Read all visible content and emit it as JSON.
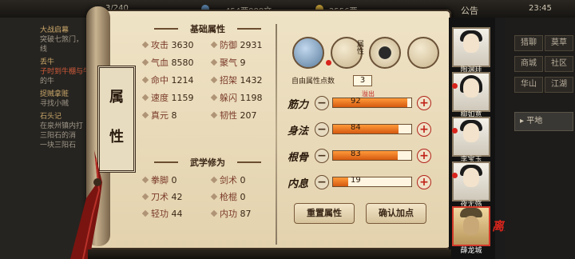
{
  "topbar": {
    "level_text": "3/240",
    "coins_text": "454两888文",
    "ingots_text": "2556两",
    "notice_label": "公告",
    "time": "23:45"
  },
  "quests": [
    {
      "title": "大战启幕",
      "desc": "突破七煞门，"
    },
    {
      "title": "",
      "desc": "线"
    },
    {
      "title": "丢牛",
      "desc": "子时到牛棚与牛"
    },
    {
      "title": "",
      "desc": "的牛"
    },
    {
      "title": "捉贼拿赃",
      "desc": "寻找小贼"
    },
    {
      "title": "石头记",
      "desc": "在泉州镇内打"
    },
    {
      "title": "",
      "desc": "三阳石的消"
    },
    {
      "title": "",
      "desc": "一块三阳石"
    }
  ],
  "title_scroll": {
    "char1": "属",
    "char2": "性"
  },
  "basic_section": {
    "title": "基础属性",
    "stats": [
      {
        "label": "攻击",
        "value": "3630"
      },
      {
        "label": "防御",
        "value": "2931"
      },
      {
        "label": "气血",
        "value": "8580"
      },
      {
        "label": "聚气",
        "value": "9"
      },
      {
        "label": "命中",
        "value": "1214"
      },
      {
        "label": "招架",
        "value": "1432"
      },
      {
        "label": "速度",
        "value": "1159"
      },
      {
        "label": "躲闪",
        "value": "1198"
      },
      {
        "label": "真元",
        "value": "8"
      },
      {
        "label": "韧性",
        "value": "207"
      }
    ]
  },
  "martial_section": {
    "title": "武学修为",
    "stats": [
      {
        "label": "拳脚",
        "value": "0"
      },
      {
        "label": "剑术",
        "value": "0"
      },
      {
        "label": "刀术",
        "value": "42"
      },
      {
        "label": "枪棍",
        "value": "0"
      },
      {
        "label": "轻功",
        "value": "44"
      },
      {
        "label": "内功",
        "value": "87"
      }
    ]
  },
  "free_points": {
    "label": "自由属性点数",
    "value": "3"
  },
  "overflow_label": "溢出",
  "attributes": [
    {
      "label": "筋力",
      "value": "92",
      "fill": 0.95
    },
    {
      "label": "身法",
      "value": "84",
      "fill": 0.84
    },
    {
      "label": "根骨",
      "value": "83",
      "fill": 0.83
    },
    {
      "label": "内息",
      "value": "19",
      "fill": 0.19
    }
  ],
  "buttons": {
    "reset": "重置属性",
    "confirm": "确认加点"
  },
  "tab_badge": "属性",
  "characters": [
    {
      "name": "陶渊珪"
    },
    {
      "name": "柳如意"
    },
    {
      "name": "李宝玉"
    },
    {
      "name": "夜无殇"
    },
    {
      "name": "薛龙城"
    }
  ],
  "leave_label": "离开",
  "menu": [
    "猎聊",
    "莫草",
    "商城",
    "社区",
    "华山",
    "江湖"
  ],
  "location_label": "平地",
  "colors": {
    "accent": "#c0201a",
    "paper": "#efe3c6",
    "bar_fill": "#e86a18"
  }
}
